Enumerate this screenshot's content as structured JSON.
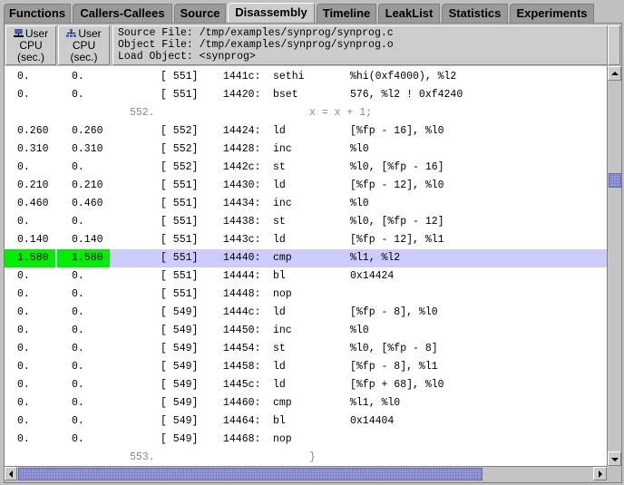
{
  "tabs": [
    {
      "label": "Functions",
      "active": false
    },
    {
      "label": "Callers-Callees",
      "active": false
    },
    {
      "label": "Source",
      "active": false
    },
    {
      "label": "Disassembly",
      "active": true
    },
    {
      "label": "Timeline",
      "active": false
    },
    {
      "label": "LeakList",
      "active": false
    },
    {
      "label": "Statistics",
      "active": false
    },
    {
      "label": "Experiments",
      "active": false
    }
  ],
  "columns": [
    {
      "icon": "exclusive-metric-icon",
      "line1": "User",
      "line2": "CPU",
      "line3": "(sec.)"
    },
    {
      "icon": "inclusive-metric-icon",
      "line1": "User",
      "line2": "CPU",
      "line3": "(sec.)"
    }
  ],
  "source_info": {
    "source_file": "Source File: /tmp/examples/synprog/synprog.c",
    "object_file": "Object File: /tmp/examples/synprog/synprog.o",
    "load_object": "Load Object: <synprog>"
  },
  "rows": [
    {
      "type": "insn",
      "excl": "0.",
      "incl": "0.",
      "line": "[ 551]",
      "addr": "1441c:",
      "op": "sethi",
      "args": "%hi(0xf4000), %l2"
    },
    {
      "type": "insn",
      "excl": "0.",
      "incl": "0.",
      "line": "[ 551]",
      "addr": "14420:",
      "op": "bset",
      "args": "576, %l2 ! 0xf4240"
    },
    {
      "type": "src",
      "srcno": "552.",
      "text": "x = x + 1;"
    },
    {
      "type": "insn",
      "excl": "0.260",
      "incl": "0.260",
      "line": "[ 552]",
      "addr": "14424:",
      "op": "ld",
      "args": "[%fp - 16], %l0"
    },
    {
      "type": "insn",
      "excl": "0.310",
      "incl": "0.310",
      "line": "[ 552]",
      "addr": "14428:",
      "op": "inc",
      "args": "%l0"
    },
    {
      "type": "insn",
      "excl": "0.",
      "incl": "0.",
      "line": "[ 552]",
      "addr": "1442c:",
      "op": "st",
      "args": "%l0, [%fp - 16]"
    },
    {
      "type": "insn",
      "excl": "0.210",
      "incl": "0.210",
      "line": "[ 551]",
      "addr": "14430:",
      "op": "ld",
      "args": "[%fp - 12], %l0"
    },
    {
      "type": "insn",
      "excl": "0.460",
      "incl": "0.460",
      "line": "[ 551]",
      "addr": "14434:",
      "op": "inc",
      "args": "%l0"
    },
    {
      "type": "insn",
      "excl": "0.",
      "incl": "0.",
      "line": "[ 551]",
      "addr": "14438:",
      "op": "st",
      "args": "%l0, [%fp - 12]"
    },
    {
      "type": "insn",
      "excl": "0.140",
      "incl": "0.140",
      "line": "[ 551]",
      "addr": "1443c:",
      "op": "ld",
      "args": "[%fp - 12], %l1"
    },
    {
      "type": "insn",
      "selected": true,
      "excl": "1.580",
      "incl": "1.580",
      "line": "[ 551]",
      "addr": "14440:",
      "op": "cmp",
      "args": "%l1, %l2"
    },
    {
      "type": "insn",
      "excl": "0.",
      "incl": "0.",
      "line": "[ 551]",
      "addr": "14444:",
      "op": "bl",
      "args": "0x14424"
    },
    {
      "type": "insn",
      "excl": "0.",
      "incl": "0.",
      "line": "[ 551]",
      "addr": "14448:",
      "op": "nop",
      "args": ""
    },
    {
      "type": "insn",
      "excl": "0.",
      "incl": "0.",
      "line": "[ 549]",
      "addr": "1444c:",
      "op": "ld",
      "args": "[%fp - 8], %l0"
    },
    {
      "type": "insn",
      "excl": "0.",
      "incl": "0.",
      "line": "[ 549]",
      "addr": "14450:",
      "op": "inc",
      "args": "%l0"
    },
    {
      "type": "insn",
      "excl": "0.",
      "incl": "0.",
      "line": "[ 549]",
      "addr": "14454:",
      "op": "st",
      "args": "%l0, [%fp - 8]"
    },
    {
      "type": "insn",
      "excl": "0.",
      "incl": "0.",
      "line": "[ 549]",
      "addr": "14458:",
      "op": "ld",
      "args": "[%fp - 8], %l1"
    },
    {
      "type": "insn",
      "excl": "0.",
      "incl": "0.",
      "line": "[ 549]",
      "addr": "1445c:",
      "op": "ld",
      "args": "[%fp + 68], %l0"
    },
    {
      "type": "insn",
      "excl": "0.",
      "incl": "0.",
      "line": "[ 549]",
      "addr": "14460:",
      "op": "cmp",
      "args": "%l1, %l0"
    },
    {
      "type": "insn",
      "excl": "0.",
      "incl": "0.",
      "line": "[ 549]",
      "addr": "14464:",
      "op": "bl",
      "args": "0x14404"
    },
    {
      "type": "insn",
      "excl": "0.",
      "incl": "0.",
      "line": "[ 549]",
      "addr": "14468:",
      "op": "nop",
      "args": ""
    },
    {
      "type": "src",
      "srcno": "553.",
      "text": "}"
    }
  ],
  "scroll": {
    "vertical_position": 0.3,
    "horizontal_visible_fraction": 0.8
  },
  "colors": {
    "selected_row": "#ccccff",
    "hot_metric": "#00ee00",
    "scroll_thumb": "#9999dd"
  }
}
